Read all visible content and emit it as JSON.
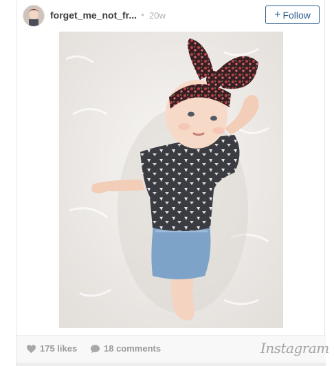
{
  "post": {
    "username": "forget_me_not_fr...",
    "separator": "•",
    "time": "20w",
    "follow_label": "Follow",
    "follow_icon": "plus-icon"
  },
  "footer": {
    "likes_label": "175 likes",
    "comments_label": "18 comments",
    "brand": "Instagram",
    "heart_icon": "heart-icon",
    "comment_icon": "comment-bubble-icon"
  },
  "colors": {
    "accent": "#2f5d8b",
    "muted": "#9a9a9a"
  }
}
